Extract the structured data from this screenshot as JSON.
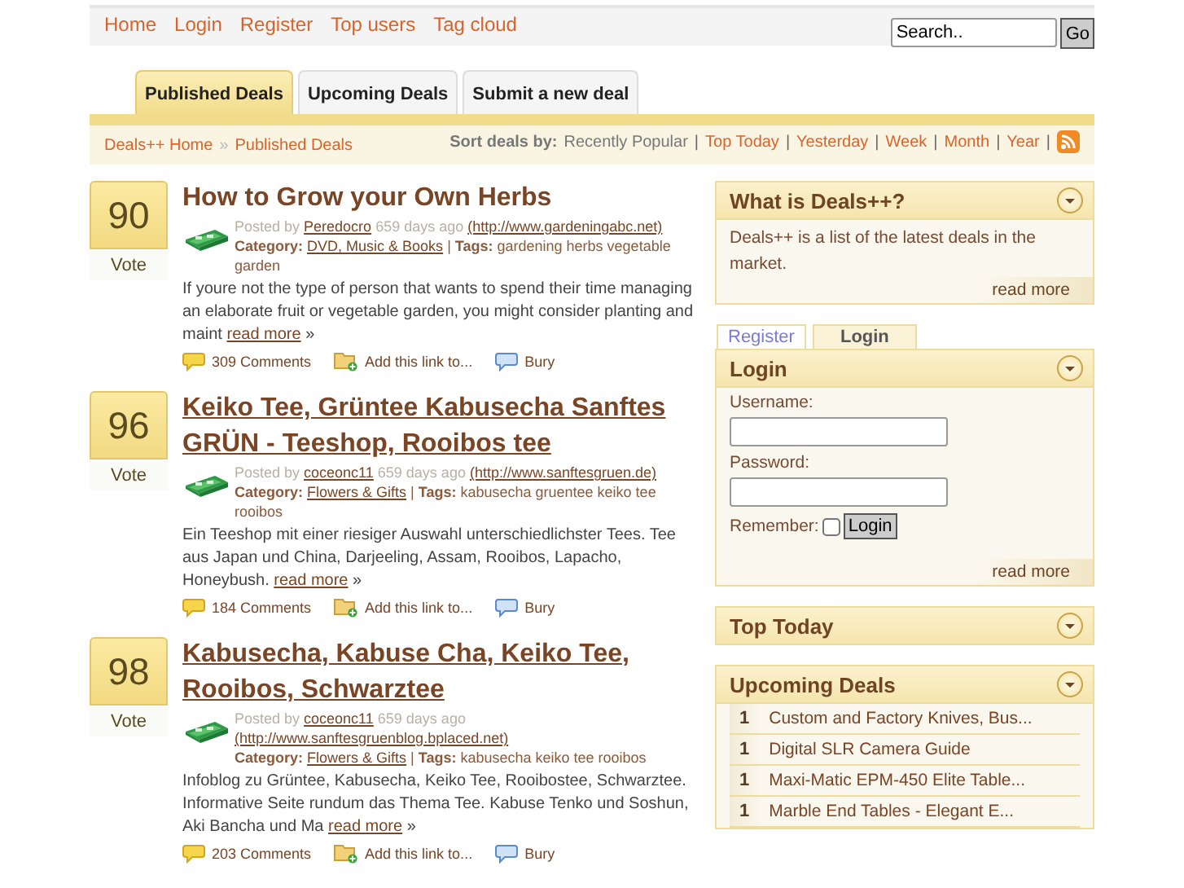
{
  "nav": [
    "Home",
    "Login",
    "Register",
    "Top users",
    "Tag cloud"
  ],
  "search": {
    "value": "Search..",
    "button": "Go"
  },
  "tabs": [
    {
      "label": "Published Deals",
      "selected": true
    },
    {
      "label": "Upcoming Deals",
      "selected": false
    },
    {
      "label": "Submit a new deal",
      "selected": false
    }
  ],
  "breadcrumb": {
    "items": [
      "Deals++ Home",
      "Published Deals"
    ],
    "separator": "»"
  },
  "sort": {
    "label": "Sort deals by:",
    "separator": "|",
    "options": [
      {
        "label": "Recently Popular",
        "selected": true
      },
      {
        "label": "Top Today",
        "selected": false
      },
      {
        "label": "Yesterday",
        "selected": false
      },
      {
        "label": "Week",
        "selected": false
      },
      {
        "label": "Month",
        "selected": false
      },
      {
        "label": "Year",
        "selected": false
      }
    ]
  },
  "meta_separator": "|",
  "read_more_mark": "»",
  "deals": [
    {
      "votes": "90",
      "vote_label": "Vote",
      "title": "How to Grow your Own Herbs",
      "posted_by": "Posted by",
      "author": "Peredocro",
      "age": "659 days ago",
      "url": "(http://www.gardeningabc.net)",
      "category_label": "Category:",
      "category": "DVD, Music & Books",
      "tags_label": "Tags:",
      "tags": "gardening herbs vegetable garden",
      "excerpt": "If youre not the type of person that wants to spend their time managing an elaborate fruit or vegetable garden, you might consider planting and maint",
      "read_more": "read more",
      "comments": "309 Comments",
      "add_link": "Add this link to...",
      "bury": "Bury"
    },
    {
      "votes": "96",
      "vote_label": "Vote",
      "title": "Keiko Tee, Grüntee Kabusecha Sanftes GRÜN - Teeshop, Rooibos tee",
      "posted_by": "Posted by",
      "author": "coceonc11",
      "age": "659 days ago",
      "url": "(http://www.sanftesgruen.de)",
      "category_label": "Category:",
      "category": "Flowers & Gifts",
      "tags_label": "Tags:",
      "tags": "kabusecha gruentee keiko tee rooibos",
      "excerpt": "Ein Teeshop mit einer riesiger Auswahl unterschiedlichster Tees. Tee aus Japan und China, Darjeeling, Assam, Rooibos, Lapacho, Honeybush.",
      "read_more": "read more",
      "comments": "184 Comments",
      "add_link": "Add this link to...",
      "bury": "Bury"
    },
    {
      "votes": "98",
      "vote_label": "Vote",
      "title": "Kabusecha, Kabuse Cha, Keiko Tee, Rooibos, Schwarztee",
      "posted_by": "Posted by",
      "author": "coceonc11",
      "age": "659 days ago",
      "url": "(http://www.sanftesgruenblog.bplaced.net)",
      "category_label": "Category:",
      "category": "Flowers & Gifts",
      "tags_label": "Tags:",
      "tags": "kabusecha keiko tee rooibos",
      "excerpt": "Infoblog zu Grüntee, Kabusecha, Keiko Tee, Rooibostee, Schwarztee. Informative Seite rundum das Thema Tee. Kabuse Tenko und Soshun, Aki Bancha und Ma",
      "read_more": "read more",
      "comments": "203 Comments",
      "add_link": "Add this link to...",
      "bury": "Bury"
    }
  ],
  "sidebar": {
    "about": {
      "title": "What is Deals++?",
      "text": "Deals++ is a list of the latest deals in the market.",
      "read_more": "read more"
    },
    "login_tabs": [
      {
        "label": "Register",
        "selected": false
      },
      {
        "label": "Login",
        "selected": true
      }
    ],
    "login": {
      "title": "Login",
      "username_label": "Username:",
      "password_label": "Password:",
      "remember_label": "Remember:",
      "remember": false,
      "button": "Login",
      "read_more": "read more"
    },
    "top_today": {
      "title": "Top Today"
    },
    "upcoming": {
      "title": "Upcoming Deals",
      "items": [
        {
          "rank": "1",
          "title": "Custom and Factory Knives, Bus..."
        },
        {
          "rank": "1",
          "title": "Digital SLR Camera Guide"
        },
        {
          "rank": "1",
          "title": "Maxi-Matic EPM-450 Elite Table..."
        },
        {
          "rank": "1",
          "title": "Marble End Tables - Elegant E..."
        }
      ]
    }
  }
}
